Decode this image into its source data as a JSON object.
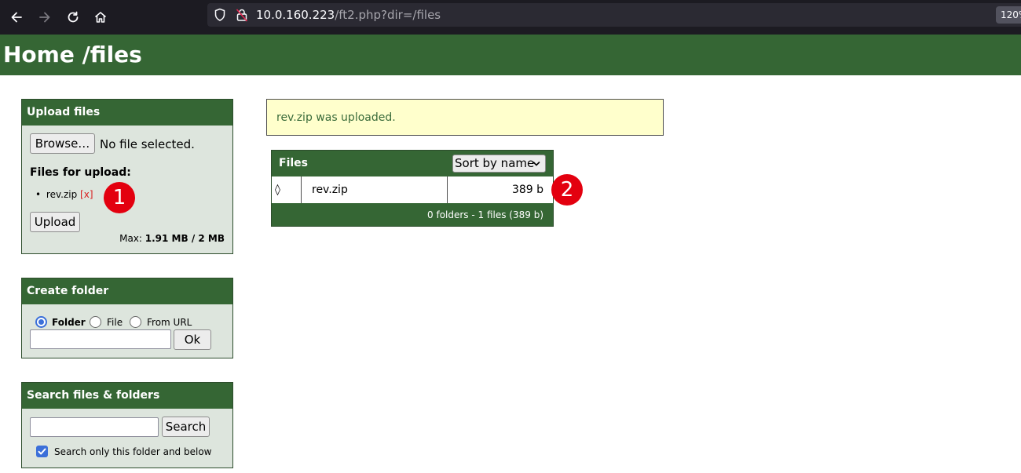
{
  "browser": {
    "url_host": "10.0.160.223",
    "url_path": "/ft2.php?dir=/files",
    "zoom": "120%"
  },
  "header": {
    "title": "Home /files"
  },
  "upload_panel": {
    "title": "Upload files",
    "browse_label": "Browse…",
    "no_file_text": "No file selected.",
    "files_for_upload_label": "Files for upload:",
    "queued_files": [
      {
        "name": "rev.zip",
        "remove_label": "[x]"
      }
    ],
    "upload_label": "Upload",
    "max_prefix": "Max: ",
    "max_value": "1.91 MB / 2 MB"
  },
  "create_panel": {
    "title": "Create folder",
    "options": [
      {
        "label": "Folder",
        "checked": true
      },
      {
        "label": "File",
        "checked": false
      },
      {
        "label": "From URL",
        "checked": false
      }
    ],
    "ok_label": "Ok"
  },
  "search_panel": {
    "title": "Search files & folders",
    "search_label": "Search",
    "checkbox_label": "Search only this folder and below",
    "checkbox_checked": true
  },
  "notice": {
    "message": "rev.zip was uploaded."
  },
  "files_table": {
    "title": "Files",
    "sort_label": "Sort by name",
    "rows": [
      {
        "icon": "◊",
        "name": "rev.zip",
        "size": "389 b"
      }
    ],
    "summary": "0 folders - 1 files (389 b)"
  },
  "markers": [
    "1",
    "2"
  ],
  "colors": {
    "header_green": "#356634",
    "panel_bg": "#dde5dd",
    "notice_bg": "#ffffcc",
    "marker_red": "#e3000f",
    "accent_blue": "#3b6fd9"
  }
}
